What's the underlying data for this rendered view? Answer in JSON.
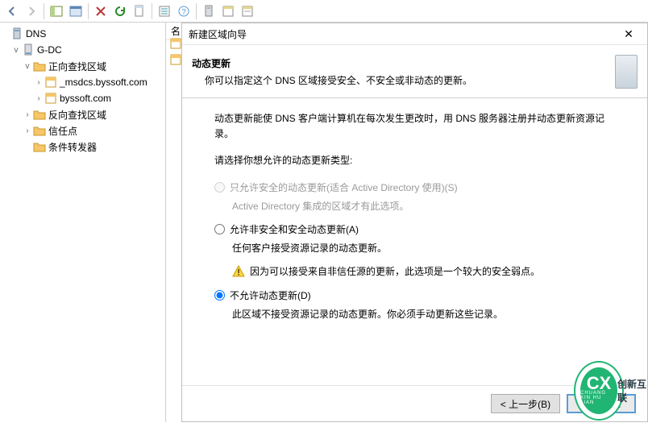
{
  "toolbar": {
    "back": "back",
    "fwd": "forward",
    "up": "up",
    "props": "properties",
    "refresh": "refresh",
    "export": "export",
    "help": "help"
  },
  "tree": {
    "root": "DNS",
    "server": "G-DC",
    "fwd_zone": "正向查找区域",
    "msdcs": "_msdcs.byssoft.com",
    "byssoft": "byssoft.com",
    "rev_zone": "反向查找区域",
    "trust": "信任点",
    "cond_fwd": "条件转发器"
  },
  "column_header": "名",
  "dialog": {
    "title": "新建区域向导",
    "heading": "动态更新",
    "subheading": "你可以指定这个 DNS 区域接受安全、不安全或非动态的更新。",
    "intro": "动态更新能使 DNS 客户端计算机在每次发生更改时，用 DNS 服务器注册并动态更新资源记录。",
    "prompt": "请选择你想允许的动态更新类型:",
    "opt1": "只允许安全的动态更新(适合 Active Directory 使用)(S)",
    "opt1_sub": "Active Directory 集成的区域才有此选项。",
    "opt2": "允许非安全和安全动态更新(A)",
    "opt2_sub": "任何客户接受资源记录的动态更新。",
    "opt2_warn": "因为可以接受来自非信任源的更新，此选项是一个较大的安全弱点。",
    "opt3": "不允许动态更新(D)",
    "opt3_sub": "此区域不接受资源记录的动态更新。你必须手动更新这些记录。",
    "btn_back": "< 上一步(B)",
    "btn_next": "下一步(N",
    "btn_close": "✕"
  },
  "colors": {
    "folder": "#f6c667",
    "folder_edge": "#c99a2d",
    "accent": "#5a9cd6"
  },
  "watermark": {
    "big": "CX",
    "sub": "CHUANG XIN HU LIAN",
    "label": "创新互联"
  }
}
